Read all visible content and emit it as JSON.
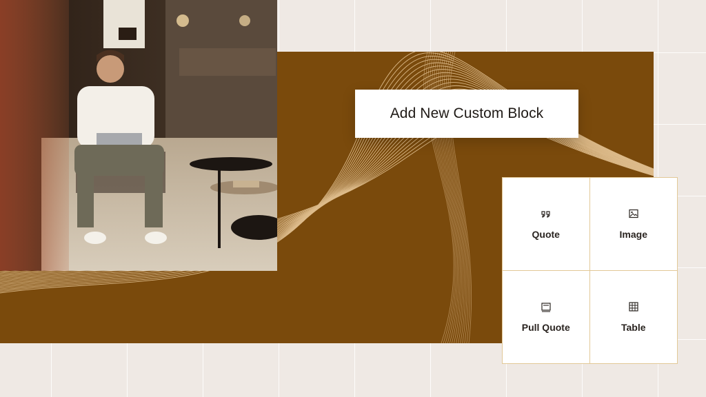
{
  "cta": {
    "label": "Add New Custom Block"
  },
  "blocks": [
    {
      "label": "Quote",
      "icon": "quote-icon"
    },
    {
      "label": "Image",
      "icon": "image-icon"
    },
    {
      "label": "Pull Quote",
      "icon": "pull-quote-icon"
    },
    {
      "label": "Table",
      "icon": "table-icon"
    }
  ],
  "colors": {
    "background": "#efe9e4",
    "brand_brown": "#7a4a0c",
    "tile_border": "#e2c896",
    "text": "#2a2420"
  }
}
